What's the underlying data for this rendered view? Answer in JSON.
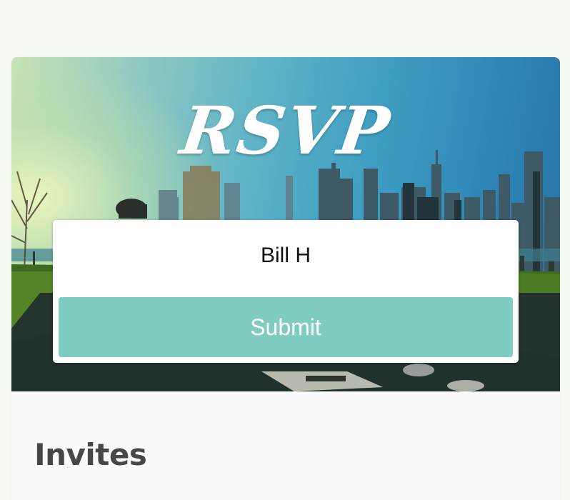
{
  "hero": {
    "title": "RSVP",
    "image": "city-skyline-park-photo"
  },
  "form": {
    "name_value": "Bill H",
    "submit_label": "Submit"
  },
  "invites": {
    "heading": "Invites"
  },
  "colors": {
    "page_background": "#f6f9f1",
    "submit_button": "#80ccc1",
    "heading_text": "#474747"
  }
}
